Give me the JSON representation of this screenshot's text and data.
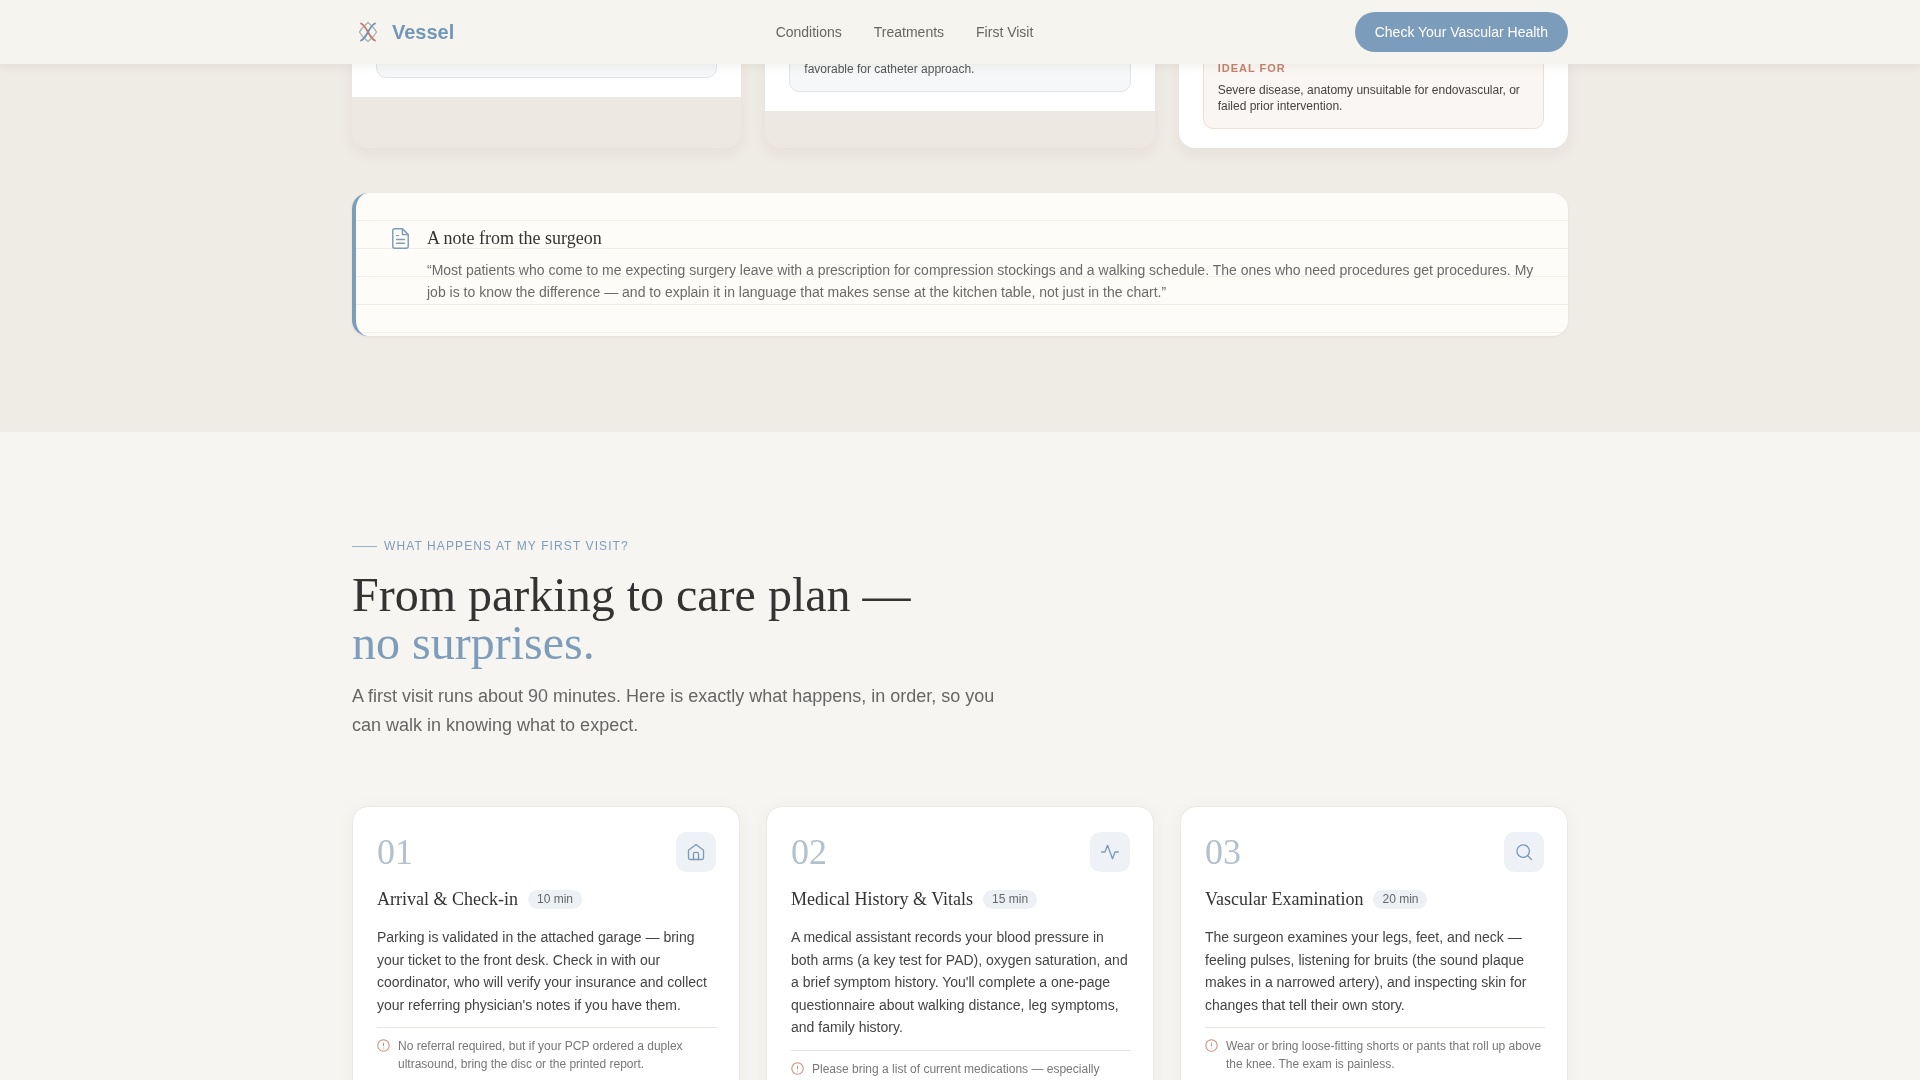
{
  "header": {
    "logo": "Vessel",
    "nav": [
      {
        "label": "Conditions"
      },
      {
        "label": "Treatments"
      },
      {
        "label": "First Visit"
      }
    ],
    "cta": "Check Your Vascular Health"
  },
  "treatment_cards": [
    {
      "kind": "plain"
    },
    {
      "kind": "plain",
      "text": "favorable for catheter approach."
    },
    {
      "kind": "ideal",
      "label": "IDEAL FOR",
      "text": "Severe disease, anatomy unsuitable for endovascular, or failed prior intervention."
    }
  ],
  "surgeon_note": {
    "title": "A note from the surgeon",
    "quote": "“Most patients who come to me expecting surgery leave with a prescription for compression stockings and a walking schedule. The ones who need procedures get procedures. My job is to know the difference — and to explain it in language that makes sense at the kitchen table, not just in the chart.”"
  },
  "first_visit": {
    "eyebrow": "WHAT HAPPENS AT MY FIRST VISIT?",
    "heading": "From parking to care plan —",
    "heading_accent": "no surprises.",
    "intro": "A first visit runs about 90 minutes. Here is exactly what happens, in order, so you can walk in knowing what to expect.",
    "steps": [
      {
        "kind": "arrival",
        "number": "01",
        "title": "Arrival & Check-in",
        "duration": "10 min",
        "text": "Parking is validated in the attached garage — bring your ticket to the front desk. Check in with our coordinator, who will verify your insurance and collect your referring physician's notes if you have them.",
        "note": "No referral required, but if your PCP ordered a duplex ultrasound, bring the disc or the printed report."
      },
      {
        "kind": "vitals",
        "number": "02",
        "title": "Medical History & Vitals",
        "duration": "15 min",
        "text": "A medical assistant records your blood pressure in both arms (a key test for PAD), oxygen saturation, and a brief symptom history. You'll complete a one-page questionnaire about walking distance, leg symptoms, and family history.",
        "note": "Please bring a list of current medications — especially"
      },
      {
        "kind": "exam",
        "number": "03",
        "title": "Vascular Examination",
        "duration": "20 min",
        "text": "The surgeon examines your legs, feet, and neck — feeling pulses, listening for bruits (the sound plaque makes in a narrowed artery), and inspecting skin for changes that tell their own story.",
        "note": "Wear or bring loose-fitting shorts or pants that roll up above the knee. The exam is painless."
      }
    ]
  }
}
